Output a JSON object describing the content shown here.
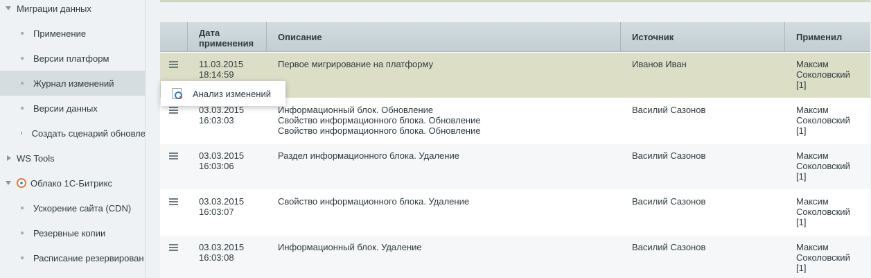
{
  "sidebar": {
    "items": [
      {
        "label": "Миграции данных",
        "type": "section",
        "expanded": true
      },
      {
        "label": "Применение",
        "type": "sub"
      },
      {
        "label": "Версии платформ",
        "type": "sub"
      },
      {
        "label": "Журнал изменений",
        "type": "sub",
        "active": true
      },
      {
        "label": "Версии данных",
        "type": "sub"
      },
      {
        "label": "Создать сценарий обновле",
        "type": "sub"
      },
      {
        "label": "WS Tools",
        "type": "section",
        "expanded": false
      },
      {
        "label": "Облако 1С-Битрикс",
        "type": "section",
        "expanded": true,
        "icon": "cloud-icon"
      },
      {
        "label": "Ускорение сайта (CDN)",
        "type": "sub"
      },
      {
        "label": "Резервные копии",
        "type": "sub"
      },
      {
        "label": "Расписание резервирован",
        "type": "sub"
      }
    ]
  },
  "table": {
    "headers": {
      "date": "Дата\nприменения",
      "description": "Описание",
      "source": "Источник",
      "applied_by": "Применил"
    },
    "rows": [
      {
        "date": "11.03.2015\n18:14:59",
        "description": "Первое мигрирование на платформу",
        "source": "Иванов Иван",
        "applied_by": "Максим\nСоколовский\n[1]"
      },
      {
        "date": "03.03.2015\n16:03:03",
        "description": "Информационный блок. Обновление\nСвойство информационного блока. Обновление\nСвойство информационного блока. Обновление",
        "source": "Василий Сазонов",
        "applied_by": "Максим\nСоколовский\n[1]"
      },
      {
        "date": "03.03.2015\n16:03:06",
        "description": "Раздел информационного блока. Удаление",
        "source": "Василий Сазонов",
        "applied_by": "Максим\nСоколовский\n[1]"
      },
      {
        "date": "03.03.2015\n16:03:07",
        "description": "Свойство информационного блока. Удаление",
        "source": "Василий Сазонов",
        "applied_by": "Максим\nСоколовский\n[1]"
      },
      {
        "date": "03.03.2015\n16:03:08",
        "description": "Информационный блок. Удаление",
        "source": "Василий Сазонов",
        "applied_by": "Максим\nСоколовский\n[1]"
      }
    ]
  },
  "popup": {
    "label": "Анализ изменений"
  }
}
